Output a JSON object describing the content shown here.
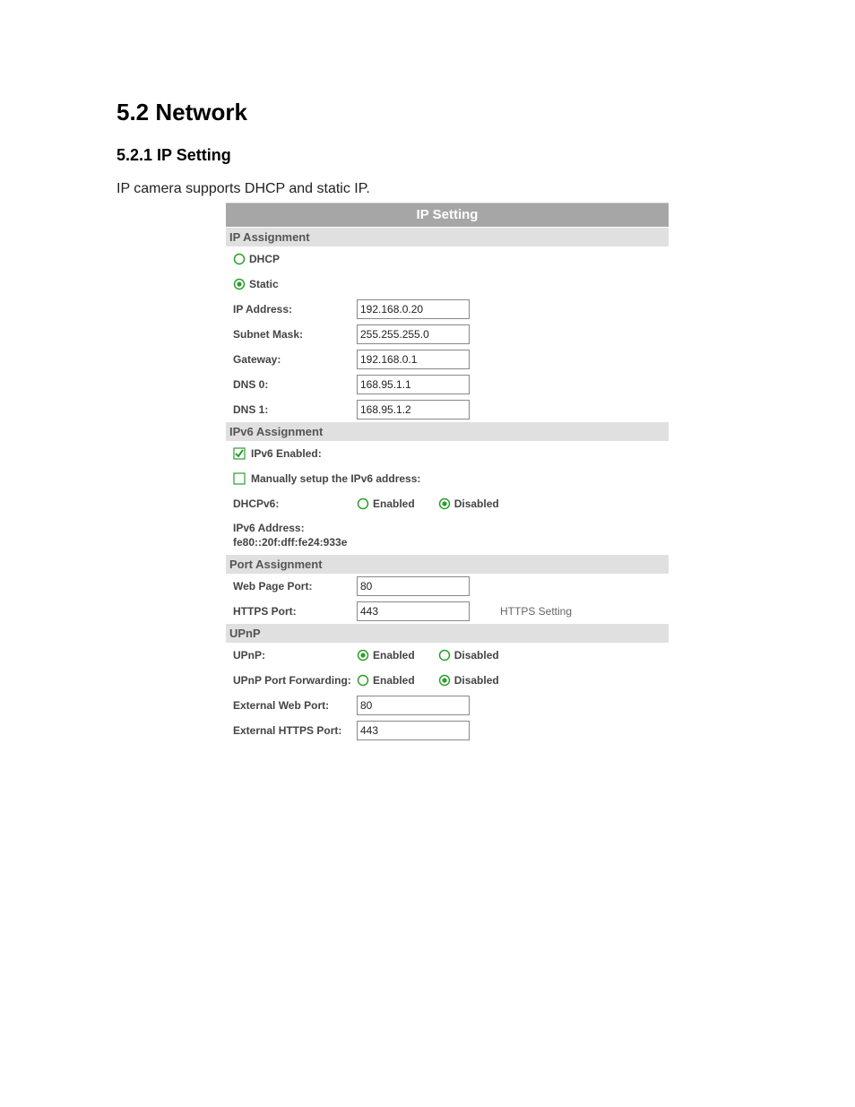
{
  "headings": {
    "main": "5.2 Network",
    "sub": "5.2.1 IP Setting",
    "intro": "IP camera supports DHCP and static IP."
  },
  "panel": {
    "title": "IP Setting",
    "ip_assignment": {
      "section_label": "IP Assignment",
      "dhcp_label": "DHCP",
      "static_label": "Static",
      "selected": "static",
      "fields": {
        "ip_address": {
          "label": "IP Address:",
          "value": "192.168.0.20"
        },
        "subnet_mask": {
          "label": "Subnet Mask:",
          "value": "255.255.255.0"
        },
        "gateway": {
          "label": "Gateway:",
          "value": "192.168.0.1"
        },
        "dns0": {
          "label": "DNS 0:",
          "value": "168.95.1.1"
        },
        "dns1": {
          "label": "DNS 1:",
          "value": "168.95.1.2"
        }
      }
    },
    "ipv6_assignment": {
      "section_label": "IPv6 Assignment",
      "ipv6_enabled": {
        "label": "IPv6 Enabled:",
        "checked": true
      },
      "manual_setup": {
        "label": "Manually setup the IPv6 address:",
        "checked": false
      },
      "dhcpv6": {
        "label": "DHCPv6:",
        "enabled_label": "Enabled",
        "disabled_label": "Disabled",
        "value": "disabled"
      },
      "ipv6_address": {
        "label": "IPv6 Address:",
        "value": "fe80::20f:dff:fe24:933e"
      }
    },
    "port_assignment": {
      "section_label": "Port Assignment",
      "web_port": {
        "label": "Web Page Port:",
        "value": "80"
      },
      "https_port": {
        "label": "HTTPS Port:",
        "value": "443",
        "link": "HTTPS Setting"
      }
    },
    "upnp": {
      "section_label": "UPnP",
      "upnp": {
        "label": "UPnP:",
        "enabled_label": "Enabled",
        "disabled_label": "Disabled",
        "value": "enabled"
      },
      "upnp_pf": {
        "label": "UPnP Port Forwarding:",
        "enabled_label": "Enabled",
        "disabled_label": "Disabled",
        "value": "disabled"
      },
      "ext_web_port": {
        "label": "External Web Port:",
        "value": "80"
      },
      "ext_https_port": {
        "label": "External HTTPS Port:",
        "value": "443"
      }
    }
  }
}
